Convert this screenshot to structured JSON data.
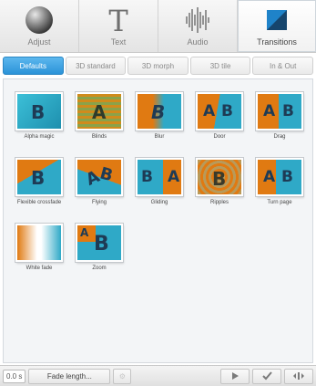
{
  "toolbar": {
    "tools": [
      {
        "label": "Adjust",
        "icon": "sphere-icon"
      },
      {
        "label": "Text",
        "icon": "letter-t-icon"
      },
      {
        "label": "Audio",
        "icon": "waveform-icon"
      },
      {
        "label": "Transitions",
        "icon": "transition-square-icon"
      }
    ],
    "active": "Transitions"
  },
  "tabs": {
    "items": [
      "Defaults",
      "3D standard",
      "3D morph",
      "3D tile",
      "In & Out"
    ],
    "active": "Defaults"
  },
  "transitions": [
    {
      "label": "Alpha magic"
    },
    {
      "label": "Blinds"
    },
    {
      "label": "Blur"
    },
    {
      "label": "Door"
    },
    {
      "label": "Drag"
    },
    {
      "label": "Flexible crossfade"
    },
    {
      "label": "Flying"
    },
    {
      "label": "Gliding"
    },
    {
      "label": "Ripples"
    },
    {
      "label": "Turn page"
    },
    {
      "label": "White fade"
    },
    {
      "label": "Zoom"
    }
  ],
  "statusbar": {
    "duration_value": "0.0 s",
    "fade_length_label": "Fade length...",
    "settings_icon": "gear-icon",
    "play_icon": "play-icon",
    "apply_icon": "checkmark-icon",
    "fit_icon": "expand-icon"
  },
  "colors": {
    "accent": "#2b93d8",
    "thumb_teal": "#27a6c5",
    "thumb_orange": "#e07a12"
  }
}
